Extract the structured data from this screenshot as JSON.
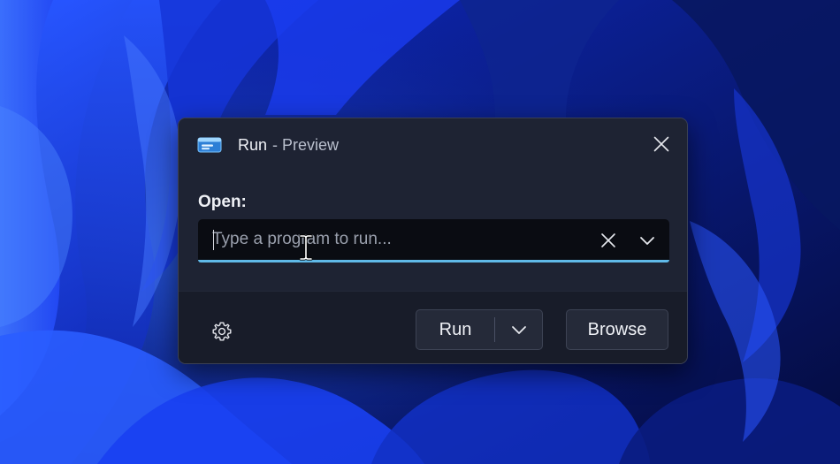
{
  "dialog": {
    "title": "Run",
    "subtitle": "- Preview",
    "app_icon": "run-app-icon",
    "close_icon": "close-icon"
  },
  "open": {
    "label": "Open:",
    "placeholder": "Type a program to run...",
    "value": "",
    "clear_icon": "close-icon",
    "dropdown_icon": "chevron-down-icon"
  },
  "footer": {
    "settings_icon": "gear-icon",
    "run_label": "Run",
    "run_dropdown_icon": "chevron-down-icon",
    "browse_label": "Browse"
  },
  "colors": {
    "accent": "#5fb9e8",
    "dialog_background": "#1e2333",
    "footer_background": "#181c29",
    "wallpaper_primary": "#1b3dff"
  }
}
